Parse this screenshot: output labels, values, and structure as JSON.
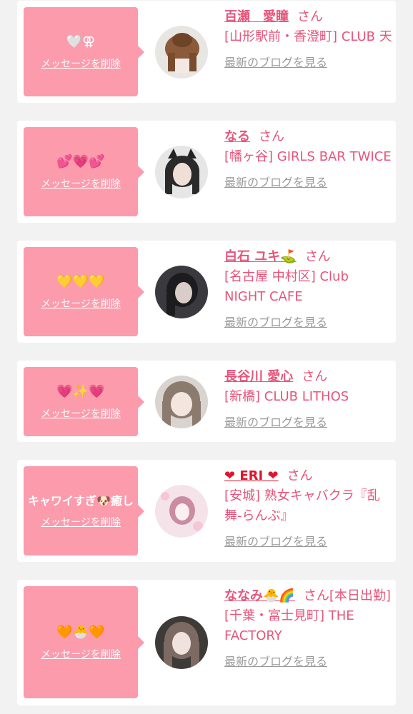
{
  "delete_label": "メッセージを削除",
  "blog_label": "最新のブログを見る",
  "honorific": "さん",
  "colors": {
    "message_box": "#fb9bac",
    "name_text": "#e6557a",
    "blog_link": "#9a9a9a",
    "background": "#f2f2f2"
  },
  "items": [
    {
      "message": "🤍⚢",
      "name": "百瀬　愛瞳",
      "shop": "[山形駅前・香澄町] CLUB 天",
      "avatar_icon": "woman-hair-updo-avatar"
    },
    {
      "message": "💕💗💕",
      "name": "なる",
      "shop": "[幡ヶ谷] GIRLS BAR TWICE",
      "avatar_icon": "woman-cat-ears-avatar"
    },
    {
      "message": "💛💛💛",
      "name": "白石 ユキ⛳",
      "shop": "[名古屋 中村区] Club NIGHT CAFE",
      "avatar_icon": "woman-dark-hair-avatar"
    },
    {
      "message": "💗✨💗",
      "name": "長谷川 愛心",
      "shop": "[新橋] CLUB LITHOS",
      "avatar_icon": "woman-light-hair-avatar"
    },
    {
      "message": "キャワイすぎ🐶癒し",
      "name": "❤ ERI ❤",
      "shop": "[安城] 熟女キャバクラ『乱舞-らんぶ』",
      "avatar_icon": "woman-blurred-avatar"
    },
    {
      "message": "🧡🐣🧡",
      "name": "ななみ🐣🌈",
      "name_suffix": "[本日出勤]",
      "shop": "[千葉・富士見町] THE FACTORY",
      "avatar_icon": "woman-long-hair-avatar"
    }
  ]
}
